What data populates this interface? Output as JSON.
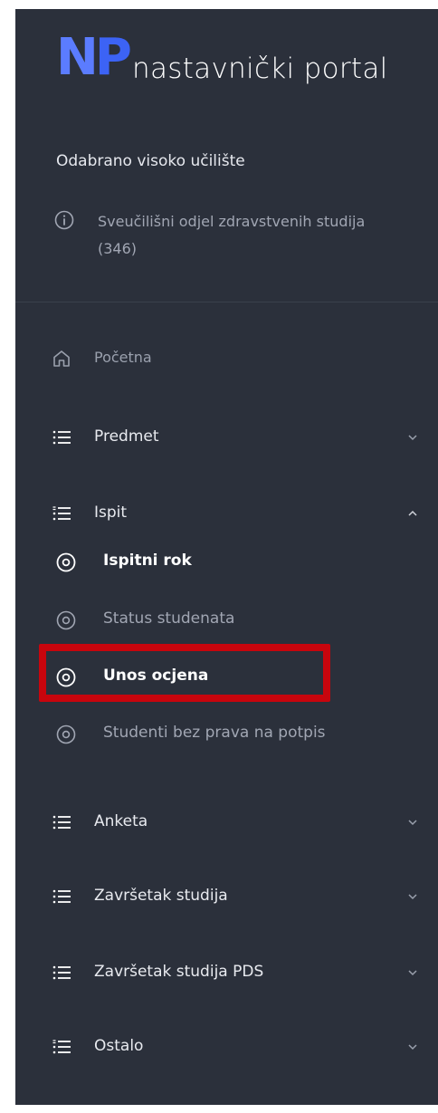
{
  "logo": {
    "mark_n": "N",
    "mark_p": "P",
    "text": "nastavnički portal"
  },
  "institution": {
    "label": "Odabrano visoko učilište",
    "name": "Sveučilišni odjel zdravstvenih studija (346)"
  },
  "nav": {
    "home": "Početna",
    "predmet": "Predmet",
    "ispit": "Ispit",
    "ispit_sub": {
      "ispitni_rok": "Ispitni rok",
      "status_studenata": "Status studenata",
      "unos_ocjena": "Unos ocjena",
      "studenti_bez_prava": "Studenti bez prava na potpis"
    },
    "anketa": "Anketa",
    "zavrsetak_studija": "Završetak studija",
    "zavrsetak_studija_pds": "Završetak studija PDS",
    "ostalo": "Ostalo"
  },
  "colors": {
    "sidebar_bg": "#2b303b",
    "brand_blue": "#3c63f5",
    "highlight_red": "#c8050d"
  }
}
